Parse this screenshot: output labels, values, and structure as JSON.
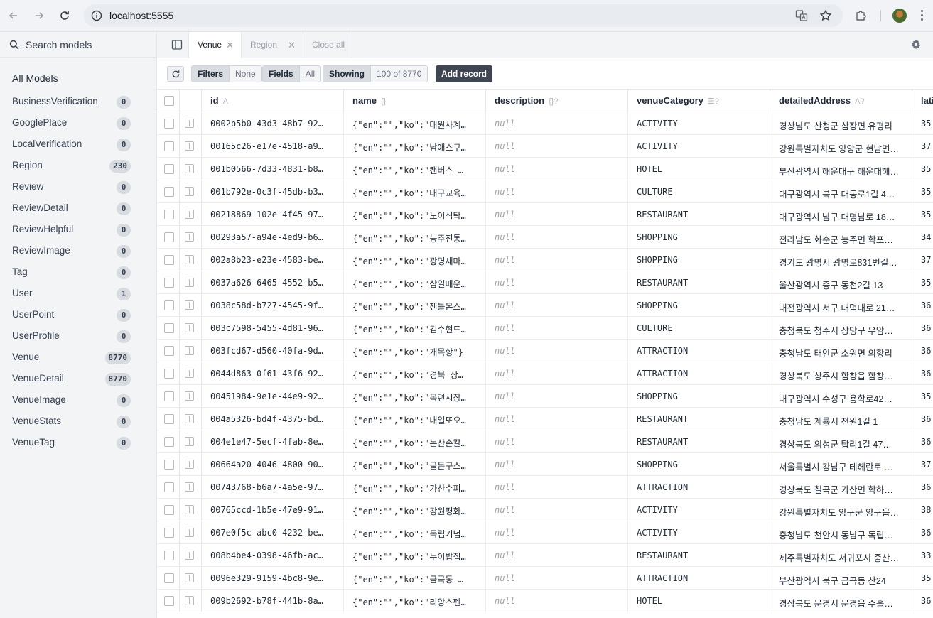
{
  "browser": {
    "url": "localhost:5555"
  },
  "sidebar": {
    "search_label": "Search models",
    "all_models_label": "All Models",
    "models": [
      {
        "name": "BusinessVerification",
        "count": "0"
      },
      {
        "name": "GooglePlace",
        "count": "0"
      },
      {
        "name": "LocalVerification",
        "count": "0"
      },
      {
        "name": "Region",
        "count": "230"
      },
      {
        "name": "Review",
        "count": "0"
      },
      {
        "name": "ReviewDetail",
        "count": "0"
      },
      {
        "name": "ReviewHelpful",
        "count": "0"
      },
      {
        "name": "ReviewImage",
        "count": "0"
      },
      {
        "name": "Tag",
        "count": "0"
      },
      {
        "name": "User",
        "count": "1"
      },
      {
        "name": "UserPoint",
        "count": "0"
      },
      {
        "name": "UserProfile",
        "count": "0"
      },
      {
        "name": "Venue",
        "count": "8770"
      },
      {
        "name": "VenueDetail",
        "count": "8770"
      },
      {
        "name": "VenueImage",
        "count": "0"
      },
      {
        "name": "VenueStats",
        "count": "0"
      },
      {
        "name": "VenueTag",
        "count": "0"
      }
    ]
  },
  "tabs": {
    "active": "Venue",
    "inactive": "Region",
    "close_all": "Close all"
  },
  "toolbar": {
    "filters_label": "Filters",
    "filters_value": "None",
    "fields_label": "Fields",
    "fields_value": "All",
    "showing_label": "Showing",
    "showing_value": "100 of 8770",
    "add_record": "Add record"
  },
  "columns": [
    {
      "label": "id",
      "type_hint": "A"
    },
    {
      "label": "name",
      "type_hint": "{}"
    },
    {
      "label": "description",
      "type_hint": "{}?"
    },
    {
      "label": "venueCategory",
      "type_hint": "☰?"
    },
    {
      "label": "detailedAddress",
      "type_hint": "A?"
    },
    {
      "label": "lati",
      "type_hint": ""
    }
  ],
  "rows": [
    {
      "id": "0002b5b0-43d3-48b7-92…",
      "name": "{\"en\":\"\",\"ko\":\"대원사계…",
      "description": "null",
      "category": "ACTIVITY",
      "address": "경상남도 산청군 삼장면 유평리",
      "lat": "35"
    },
    {
      "id": "00165c26-e17e-4518-a9…",
      "name": "{\"en\":\"\",\"ko\":\"남애스쿠…",
      "description": "null",
      "category": "ACTIVITY",
      "address": "강원특별자치도 양양군 현남면…",
      "lat": "37"
    },
    {
      "id": "001b0566-7d33-4831-b8…",
      "name": "{\"en\":\"\",\"ko\":\"캔버스 …",
      "description": "null",
      "category": "HOTEL",
      "address": "부산광역시 해운대구 해운대해…",
      "lat": "35"
    },
    {
      "id": "001b792e-0c3f-45db-b3…",
      "name": "{\"en\":\"\",\"ko\":\"대구교육…",
      "description": "null",
      "category": "CULTURE",
      "address": "대구광역시 북구 대동로1길 4…",
      "lat": "35"
    },
    {
      "id": "00218869-102e-4f45-97…",
      "name": "{\"en\":\"\",\"ko\":\"노이식탁…",
      "description": "null",
      "category": "RESTAURANT",
      "address": "대구광역시 남구 대명남로 18…",
      "lat": "35"
    },
    {
      "id": "00293a57-a94e-4ed9-b6…",
      "name": "{\"en\":\"\",\"ko\":\"능주전통…",
      "description": "null",
      "category": "SHOPPING",
      "address": "전라남도 화순군 능주면 학포…",
      "lat": "34"
    },
    {
      "id": "002a8b23-e23e-4583-be…",
      "name": "{\"en\":\"\",\"ko\":\"광명새마…",
      "description": "null",
      "category": "SHOPPING",
      "address": "경기도 광명시 광명로831번길…",
      "lat": "37"
    },
    {
      "id": "0037a626-6465-4552-b5…",
      "name": "{\"en\":\"\",\"ko\":\"삼일매운…",
      "description": "null",
      "category": "RESTAURANT",
      "address": "울산광역시 중구 동천2길 13",
      "lat": "35"
    },
    {
      "id": "0038c58d-b727-4545-9f…",
      "name": "{\"en\":\"\",\"ko\":\"젠틀몬스…",
      "description": "null",
      "category": "SHOPPING",
      "address": "대전광역시 서구 대덕대로 21…",
      "lat": "36"
    },
    {
      "id": "003c7598-5455-4d81-96…",
      "name": "{\"en\":\"\",\"ko\":\"김수현드…",
      "description": "null",
      "category": "CULTURE",
      "address": "충청북도 청주시 상당구 우암…",
      "lat": "36"
    },
    {
      "id": "003fcd67-d560-40fa-9d…",
      "name": "{\"en\":\"\",\"ko\":\"개목항\"}",
      "description": "null",
      "category": "ATTRACTION",
      "address": "충청남도 태안군 소원면 의항리",
      "lat": "36"
    },
    {
      "id": "0044d863-0f61-43f6-92…",
      "name": "{\"en\":\"\",\"ko\":\"경북 상…",
      "description": "null",
      "category": "ATTRACTION",
      "address": "경상북도 상주시 함창읍 함창…",
      "lat": "36"
    },
    {
      "id": "00451984-9e1e-44e9-92…",
      "name": "{\"en\":\"\",\"ko\":\"목련시장…",
      "description": "null",
      "category": "SHOPPING",
      "address": "대구광역시 수성구 용학로42…",
      "lat": "35"
    },
    {
      "id": "004a5326-bd4f-4375-bd…",
      "name": "{\"en\":\"\",\"ko\":\"내일또오…",
      "description": "null",
      "category": "RESTAURANT",
      "address": "충청남도 계룡시 전원1길 1",
      "lat": "36"
    },
    {
      "id": "004e1e47-5ecf-4fab-8e…",
      "name": "{\"en\":\"\",\"ko\":\"논산손칼…",
      "description": "null",
      "category": "RESTAURANT",
      "address": "경상북도 의성군 탑리1길 47…",
      "lat": "36"
    },
    {
      "id": "00664a20-4046-4800-90…",
      "name": "{\"en\":\"\",\"ko\":\"골든구스…",
      "description": "null",
      "category": "SHOPPING",
      "address": "서울특별시 강남구 테헤란로 …",
      "lat": "37"
    },
    {
      "id": "00743768-b6a7-4a5e-97…",
      "name": "{\"en\":\"\",\"ko\":\"가산수피…",
      "description": "null",
      "category": "ATTRACTION",
      "address": "경상북도 칠곡군 가산면 학하…",
      "lat": "36"
    },
    {
      "id": "00765ccd-1b5e-47e9-91…",
      "name": "{\"en\":\"\",\"ko\":\"강원평화…",
      "description": "null",
      "category": "ACTIVITY",
      "address": "강원특별자치도 양구군 양구읍…",
      "lat": "38"
    },
    {
      "id": "007e0f5c-abc0-4232-be…",
      "name": "{\"en\":\"\",\"ko\":\"독립기념…",
      "description": "null",
      "category": "ACTIVITY",
      "address": "충청남도 천안시 동남구 독립…",
      "lat": "36"
    },
    {
      "id": "008b4be4-0398-46fb-ac…",
      "name": "{\"en\":\"\",\"ko\":\"누이밥집…",
      "description": "null",
      "category": "RESTAURANT",
      "address": "제주특별자치도 서귀포시 중산…",
      "lat": "33"
    },
    {
      "id": "0096e329-9159-4bc8-9e…",
      "name": "{\"en\":\"\",\"ko\":\"금곡동 …",
      "description": "null",
      "category": "ATTRACTION",
      "address": "부산광역시 북구 금곡동 산24",
      "lat": "35"
    },
    {
      "id": "009b2692-b78f-441b-8a…",
      "name": "{\"en\":\"\",\"ko\":\"리앙스펜…",
      "description": "null",
      "category": "HOTEL",
      "address": "경상북도 문경시 문경읍 주흘…",
      "lat": "36"
    }
  ]
}
